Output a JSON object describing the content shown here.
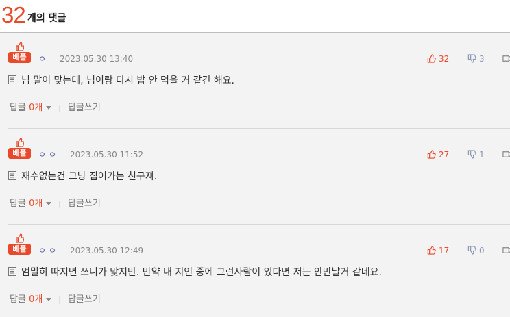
{
  "header": {
    "count": "32",
    "label": "개의 댓글"
  },
  "badge": {
    "label": "베플"
  },
  "comments": [
    {
      "nick": "ㅇ",
      "date": "2023.05.30 13:40",
      "up": "32",
      "down": "3",
      "text": "님 말이 맞는데, 님이랑 다시 밥 안 먹을 거 같긴 해요.",
      "reply_label": "답글",
      "reply_count": "0개",
      "write_reply": "답글쓰기"
    },
    {
      "nick": "ㅇㅇ",
      "date": "2023.05.30 11:52",
      "up": "27",
      "down": "1",
      "text": "재수없는건 그냥 집어가는 친구져.",
      "reply_label": "답글",
      "reply_count": "0개",
      "write_reply": "답글쓰기"
    },
    {
      "nick": "ㅇㅇ",
      "date": "2023.05.30 12:49",
      "up": "17",
      "down": "0",
      "text": "엄밀히 따지면 쓰니가 맞지만. 만약 내 지인 중에 그런사람이 있다면 저는 안만날거 같네요.",
      "reply_label": "답글",
      "reply_count": "0개",
      "write_reply": "답글쓰기"
    }
  ],
  "colors": {
    "accent": "#e8492b",
    "down": "#8a98b3",
    "bg": "#f3f3f3"
  }
}
